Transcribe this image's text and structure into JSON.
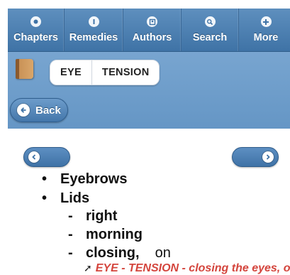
{
  "nav": {
    "items": [
      {
        "label": "Chapters",
        "icon": "chapters-icon"
      },
      {
        "label": "Remedies",
        "icon": "remedies-icon"
      },
      {
        "label": "Authors",
        "icon": "authors-icon"
      },
      {
        "label": "Search",
        "icon": "search-icon"
      },
      {
        "label": "More",
        "icon": "plus-icon"
      }
    ]
  },
  "header": {
    "book_icon": "book-icon",
    "breadcrumb": [
      "EYE",
      "TENSION"
    ],
    "back_label": "Back"
  },
  "content": {
    "level1": [
      "Eyebrows",
      "Lids"
    ],
    "level2": [
      {
        "label": "right",
        "suffix": ""
      },
      {
        "label": "morning",
        "suffix": ""
      },
      {
        "label": "closing,",
        "suffix": "on"
      }
    ],
    "xref_text": "EYE - TENSION - closing the eyes, on"
  },
  "colors": {
    "nav_bg": "#4f82b4",
    "header_bg": "#6e9ecb",
    "xref": "#d4453d"
  }
}
